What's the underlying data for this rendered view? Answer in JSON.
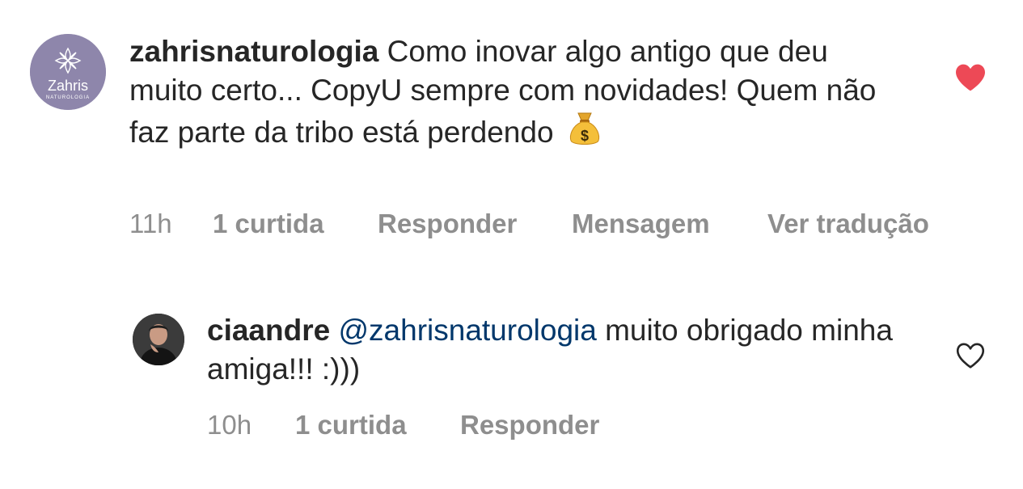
{
  "comments": [
    {
      "username": "zahrisnaturologia",
      "text": "Como inovar algo antigo que deu muito certo... CopyU sempre com novidades! Quem não faz parte da tribo está perdendo",
      "emoji": "money-bag-icon",
      "avatar": {
        "brand": "Zahris",
        "tagline": "NATUROLOGIA",
        "color": "#8e86ab"
      },
      "time": "11h",
      "likes": "1 curtida",
      "actions": [
        "Responder",
        "Mensagem",
        "Ver tradução"
      ],
      "liked": true,
      "heart_color": "#ed4956"
    },
    {
      "username": "ciaandre",
      "mention": "@zahrisnaturologia",
      "text": "muito obrigado minha amiga!!! :)))",
      "time": "10h",
      "likes": "1 curtida",
      "actions": [
        "Responder"
      ],
      "liked": false,
      "heart_color": "#262626"
    }
  ],
  "colors": {
    "text": "#262626",
    "secondary": "#8e8e8e",
    "mention": "#00376b"
  }
}
